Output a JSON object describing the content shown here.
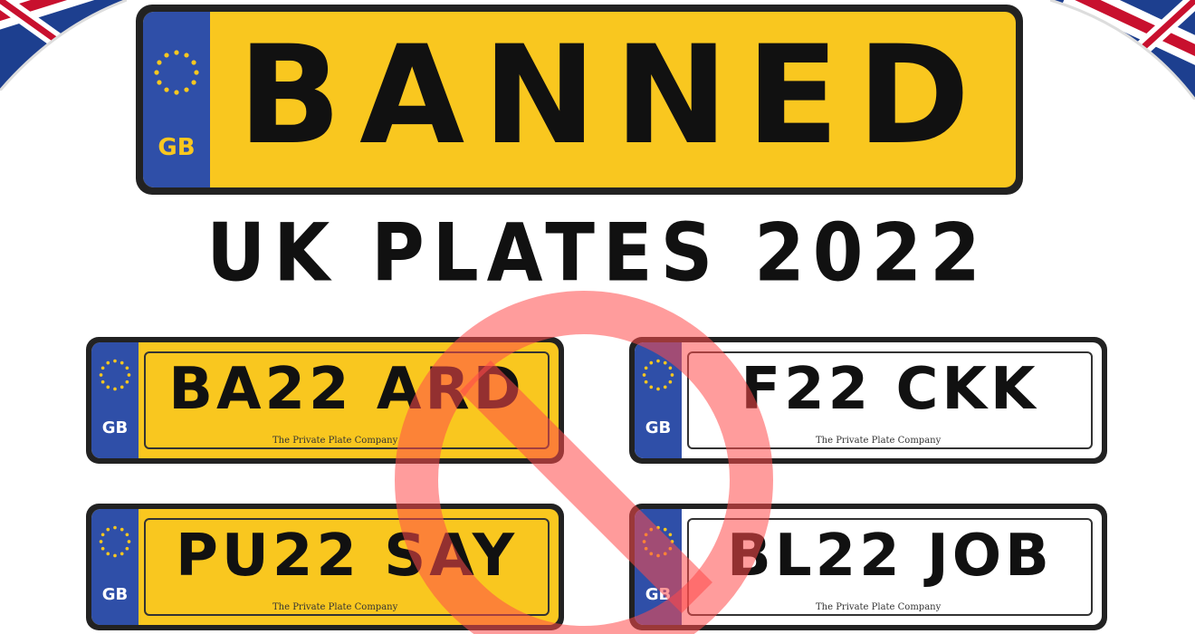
{
  "colors": {
    "plate_yellow": "#f9c71f",
    "plate_white": "#ffffff",
    "eu_band_blue": "#2f4fa8",
    "plate_border": "#222222",
    "ban_sign_red": "#ff4a4a",
    "union_jack_red": "#c8102e",
    "union_jack_blue": "#1d3f8f"
  },
  "main_plate": {
    "band_label": "GB",
    "registration": "BANNED",
    "color": "yellow",
    "icon": "eu-stars-icon"
  },
  "headline": "UK PLATES 2022",
  "banned_plates": [
    {
      "band_label": "GB",
      "registration": "BA22 ARD",
      "maker": "The Private Plate Company",
      "color": "yellow"
    },
    {
      "band_label": "GB",
      "registration": "F22 CKK",
      "maker": "The Private Plate Company",
      "color": "white"
    },
    {
      "band_label": "GB",
      "registration": "PU22 SAY",
      "maker": "The Private Plate Company",
      "color": "yellow"
    },
    {
      "band_label": "GB",
      "registration": "BL22 JOB",
      "maker": "The Private Plate Company",
      "color": "white"
    }
  ],
  "decorations": {
    "ban_sign_icon": "prohibition-sign-icon",
    "flag_icon": "union-jack-flag-icon"
  }
}
